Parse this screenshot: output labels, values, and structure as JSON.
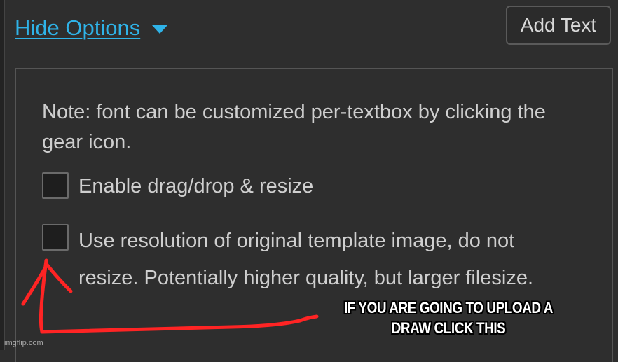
{
  "toolbar": {
    "hide_options_label": "Hide Options",
    "add_text_label": "Add Text"
  },
  "options": {
    "note": "Note: font can be customized per-textbox by clicking the gear icon.",
    "checkboxes": [
      {
        "label": "Enable drag/drop & resize",
        "checked": false
      },
      {
        "label": "Use resolution of original template image, do not resize. Potentially higher quality, but larger filesize.",
        "checked": false
      }
    ]
  },
  "annotation": {
    "caption": "IF YOU ARE GOING TO UPLOAD A DRAW CLICK THIS",
    "arrow_color": "#ff2424"
  },
  "watermark": "imgflip.com",
  "colors": {
    "link": "#2fb3e8",
    "background": "#2e2e2e",
    "text": "#cfcfcf"
  },
  "icons": {
    "dropdown": "caret-down-icon"
  }
}
